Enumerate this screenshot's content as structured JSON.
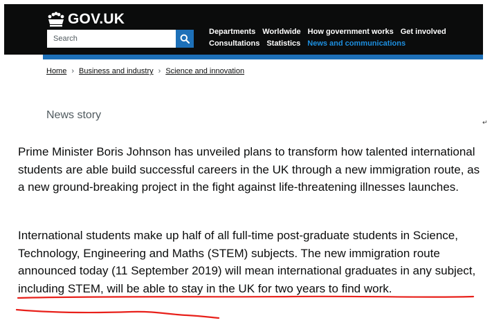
{
  "header": {
    "logo_text": "GOV.UK",
    "search": {
      "placeholder": "Search"
    },
    "nav": [
      {
        "label": "Departments",
        "active": false
      },
      {
        "label": "Worldwide",
        "active": false
      },
      {
        "label": "How government works",
        "active": false
      },
      {
        "label": "Get involved",
        "active": false
      },
      {
        "label": "Consultations",
        "active": false
      },
      {
        "label": "Statistics",
        "active": false
      },
      {
        "label": "News and communications",
        "active": true
      }
    ]
  },
  "breadcrumb": [
    "Home",
    "Business and industry",
    "Science and innovation"
  ],
  "article": {
    "category": "News story",
    "paragraphs": [
      "Prime Minister Boris Johnson has unveiled plans to transform how talented international students are able build successful careers in the UK through a new immigration route, as a new ground-breaking project in the fight against life-threatening illnesses launches.",
      "International students make up half of all full-time post-graduate students in Science, Technology, Engineering and Maths (STEM) subjects. The new immigration route announced today (11 September 2019) will mean international graduates in any subject, including STEM, will be able to stay in the UK for two years to find work."
    ]
  },
  "colors": {
    "header_bg": "#0b0c0c",
    "accent_blue": "#1d70b8",
    "active_link": "#1d8fe0",
    "annotation_red": "#e8201a"
  },
  "icons": [
    "crown-icon",
    "search-icon",
    "return-mark-icon"
  ],
  "symbols": {
    "return_mark": "↵",
    "separator": "›"
  }
}
